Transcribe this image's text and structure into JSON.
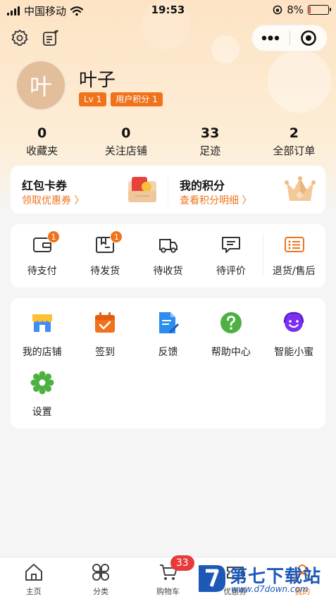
{
  "status_bar": {
    "carrier": "中国移动",
    "time": "19:53",
    "battery": "8%",
    "battery_level": 0.08
  },
  "profile": {
    "avatar_char": "叶",
    "name": "叶子",
    "level": "Lv 1",
    "points_badge": "用户积分 1"
  },
  "stats": [
    {
      "value": "0",
      "label": "收藏夹"
    },
    {
      "value": "0",
      "label": "关注店铺"
    },
    {
      "value": "33",
      "label": "足迹"
    },
    {
      "value": "2",
      "label": "全部订单"
    }
  ],
  "wallet": {
    "coupons": {
      "title": "红包卡券",
      "link": "领取优惠券 〉"
    },
    "points": {
      "title": "我的积分",
      "link": "查看积分明细 〉"
    }
  },
  "orders": [
    {
      "label": "待支付",
      "badge": "1",
      "icon": "wallet-icon"
    },
    {
      "label": "待发货",
      "badge": "1",
      "icon": "package-icon"
    },
    {
      "label": "待收货",
      "badge": "",
      "icon": "truck-icon"
    },
    {
      "label": "待评价",
      "badge": "",
      "icon": "comment-icon"
    },
    {
      "label": "退货/售后",
      "badge": "",
      "icon": "return-list-icon"
    }
  ],
  "tools": [
    {
      "label": "我的店铺",
      "icon": "store-icon"
    },
    {
      "label": "签到",
      "icon": "calendar-check-icon"
    },
    {
      "label": "反馈",
      "icon": "document-edit-icon"
    },
    {
      "label": "帮助中心",
      "icon": "help-icon"
    },
    {
      "label": "智能小蜜",
      "icon": "smiley-headset-icon"
    },
    {
      "label": "设置",
      "icon": "gear-icon"
    }
  ],
  "tabbar": [
    {
      "label": "主页",
      "icon": "home-icon"
    },
    {
      "label": "分类",
      "icon": "category-icon"
    },
    {
      "label": "购物车",
      "icon": "cart-icon",
      "badge": "33"
    },
    {
      "label": "优惠券",
      "icon": "coupon-icon"
    },
    {
      "label": "我的",
      "icon": "user-icon",
      "active": true
    }
  ],
  "watermark": {
    "text": "第七下载站",
    "url": "www.d7down.com"
  },
  "colors": {
    "accent": "#f0731c",
    "badge_red": "#e83a3a",
    "header_bg": "#fde3c4"
  }
}
